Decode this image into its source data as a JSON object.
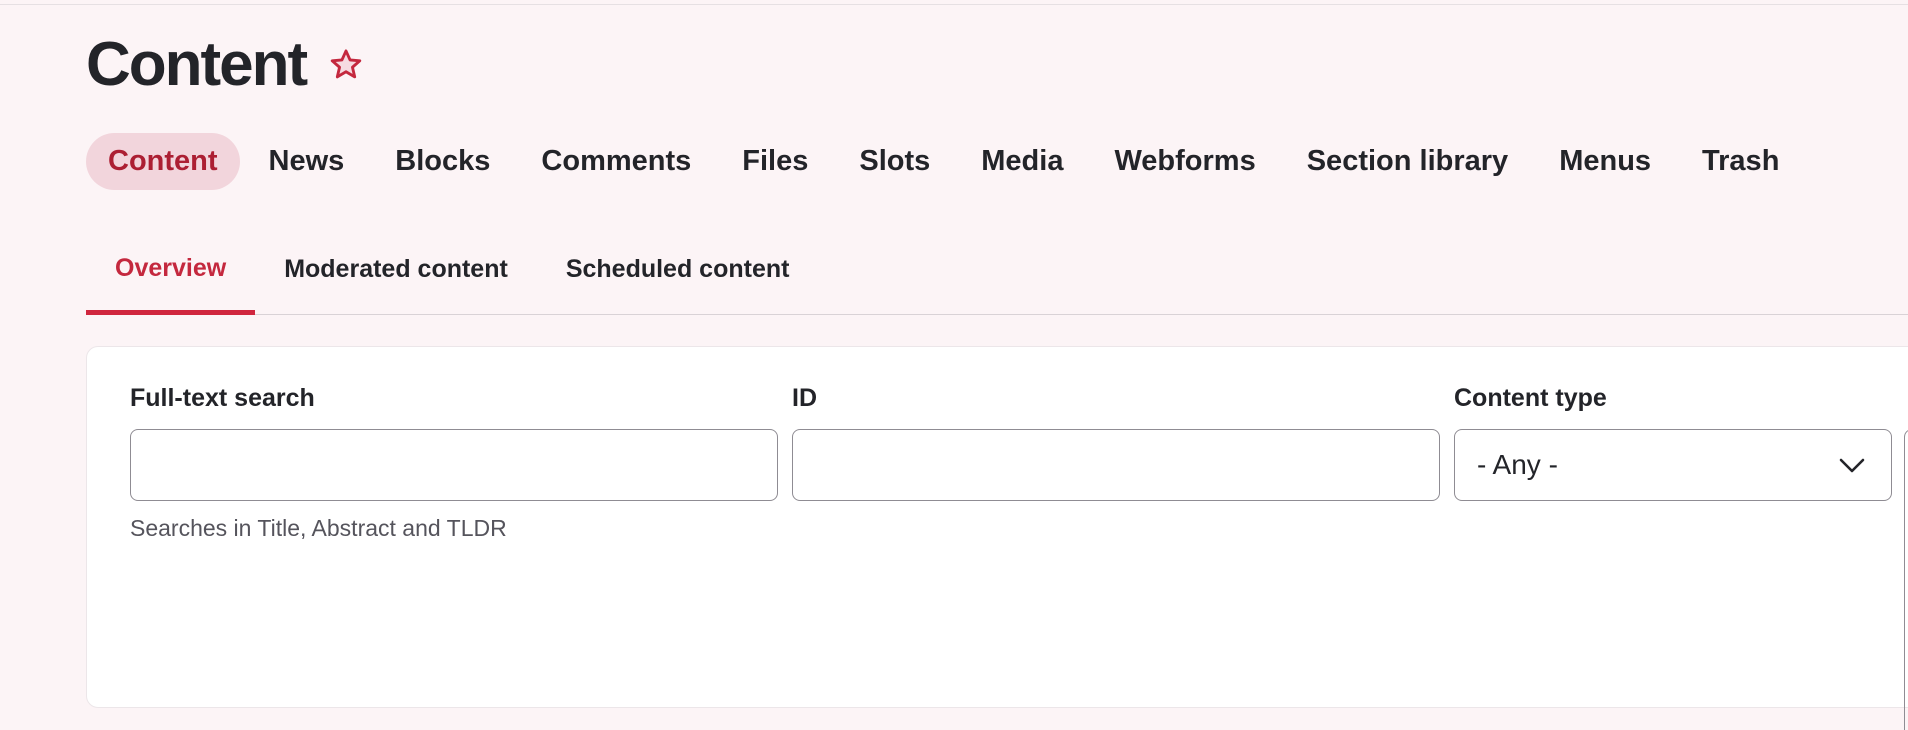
{
  "page": {
    "title": "Content"
  },
  "primary_tabs": [
    {
      "label": "Content",
      "active": true
    },
    {
      "label": "News"
    },
    {
      "label": "Blocks"
    },
    {
      "label": "Comments"
    },
    {
      "label": "Files"
    },
    {
      "label": "Slots"
    },
    {
      "label": "Media"
    },
    {
      "label": "Webforms"
    },
    {
      "label": "Section library"
    },
    {
      "label": "Menus"
    },
    {
      "label": "Trash"
    }
  ],
  "secondary_tabs": [
    {
      "label": "Overview",
      "active": true
    },
    {
      "label": "Moderated content"
    },
    {
      "label": "Scheduled content"
    }
  ],
  "filters": {
    "fulltext": {
      "label": "Full-text search",
      "value": "",
      "description": "Searches in Title, Abstract and TLDR"
    },
    "id": {
      "label": "ID",
      "value": ""
    },
    "content_type": {
      "label": "Content type",
      "selected": "- Any -"
    }
  },
  "colors": {
    "accent": "#c4283e",
    "active_pill_bg": "#f2d5dc",
    "page_bg": "#fcf4f6"
  },
  "icons": {
    "favorite": "star-outline-icon",
    "select_caret": "chevron-down-icon"
  }
}
